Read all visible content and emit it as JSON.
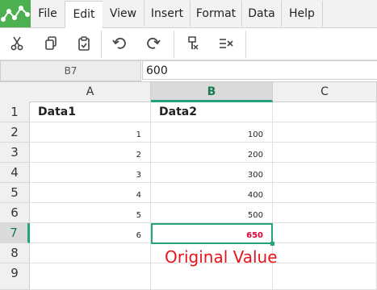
{
  "menu": {
    "tabs": [
      {
        "label": "File"
      },
      {
        "label": "Edit"
      },
      {
        "label": "View"
      },
      {
        "label": "Insert"
      },
      {
        "label": "Format"
      },
      {
        "label": "Data"
      },
      {
        "label": "Help"
      }
    ],
    "active_tab": "Edit"
  },
  "toolbar": {
    "buttons": [
      {
        "icon": "scissors-icon"
      },
      {
        "icon": "copy-icon"
      },
      {
        "icon": "paste-icon"
      },
      {
        "icon": "undo-icon"
      },
      {
        "icon": "redo-icon"
      },
      {
        "icon": "clear-formats-icon"
      },
      {
        "icon": "clear-contents-icon"
      }
    ]
  },
  "formula_bar": {
    "cell_ref": "B7",
    "value": "600"
  },
  "grid": {
    "columns": [
      "A",
      "B",
      "C"
    ],
    "selected_column": "B",
    "rows": [
      "1",
      "2",
      "3",
      "4",
      "5",
      "6",
      "7",
      "8",
      "9"
    ],
    "selected_row": "7",
    "cells": {
      "A1": "Data1",
      "B1": "Data2",
      "A2": "1",
      "B2": "100",
      "A3": "2",
      "B3": "200",
      "A4": "3",
      "B4": "300",
      "A5": "4",
      "B5": "400",
      "A6": "5",
      "B6": "500",
      "A7": "6",
      "B7": "650"
    }
  },
  "annotation": "Original Value",
  "colors": {
    "accent": "#22a27d",
    "highlight_text": "#e0003a",
    "annotation": "#e8141a",
    "logo": "#4caf50"
  }
}
